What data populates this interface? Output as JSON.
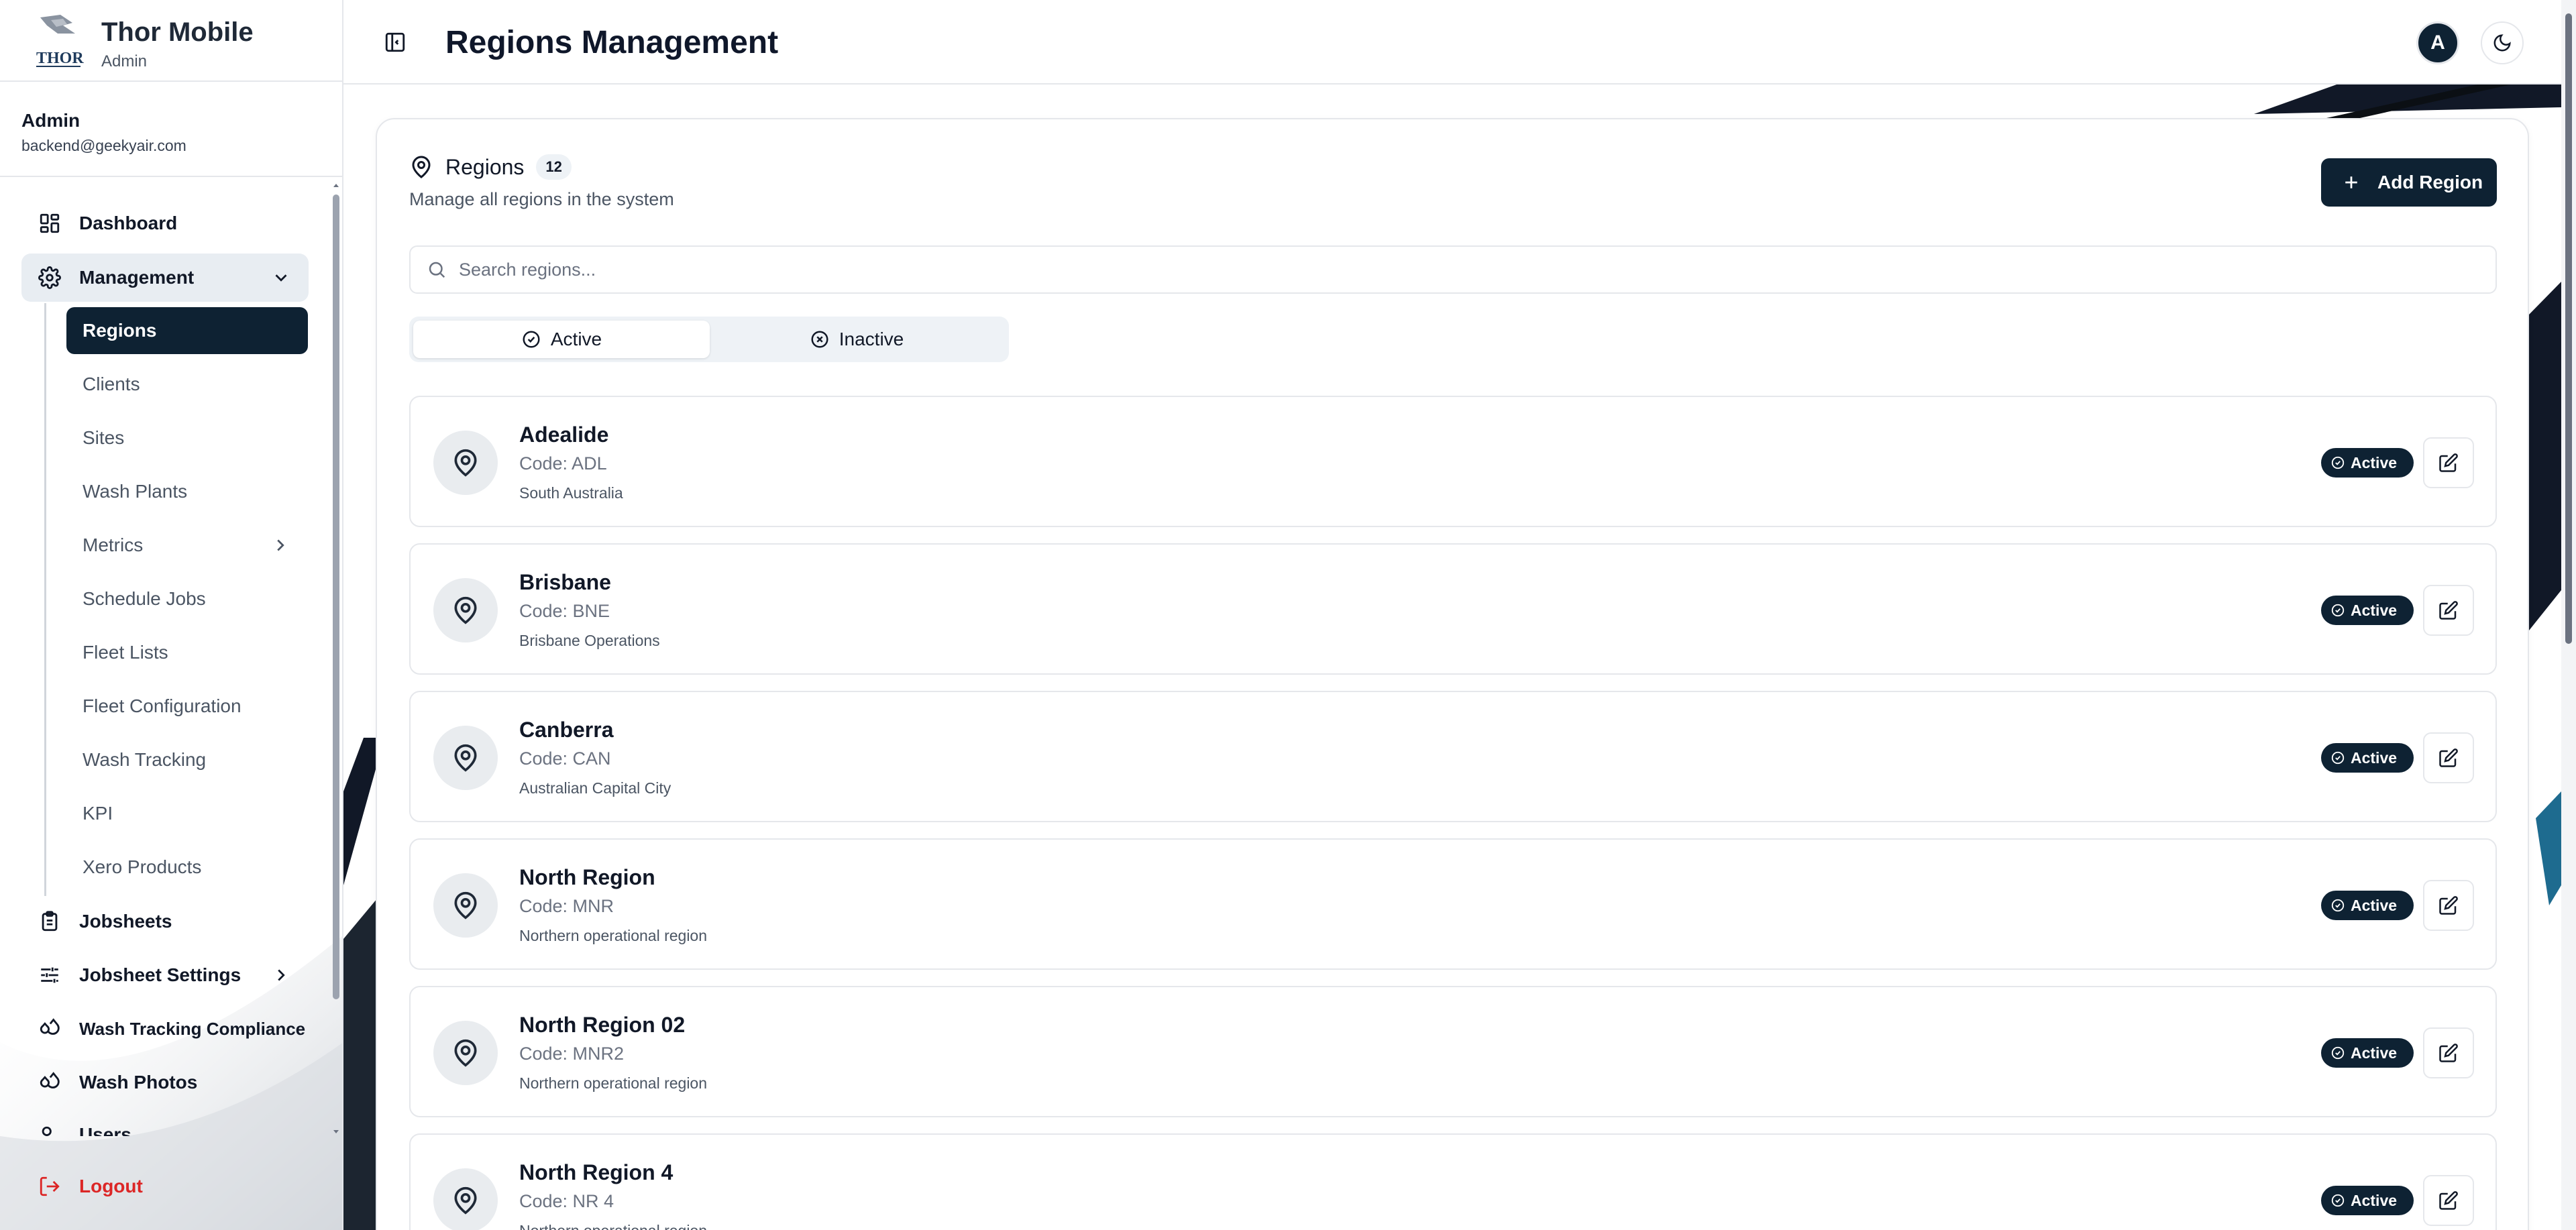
{
  "brand": {
    "name": "Thor Mobile",
    "subtitle": "Admin",
    "logo_text": "THOR"
  },
  "user": {
    "name": "Admin",
    "email": "backend@geekyair.com"
  },
  "nav": {
    "dashboard": "Dashboard",
    "management": "Management",
    "sub": {
      "regions": "Regions",
      "clients": "Clients",
      "sites": "Sites",
      "wash_plants": "Wash Plants",
      "metrics": "Metrics",
      "schedule_jobs": "Schedule Jobs",
      "fleet_lists": "Fleet Lists",
      "fleet_configuration": "Fleet Configuration",
      "wash_tracking": "Wash Tracking",
      "kpi": "KPI",
      "xero_products": "Xero Products"
    },
    "jobsheets": "Jobsheets",
    "jobsheet_settings": "Jobsheet Settings",
    "wash_tracking_compliance": "Wash Tracking Compliance",
    "wash_photos": "Wash Photos",
    "users": "Users",
    "logout": "Logout"
  },
  "header": {
    "title": "Regions Management",
    "avatar_initial": "A"
  },
  "regions": {
    "title": "Regions",
    "count": "12",
    "description": "Manage all regions in the system",
    "add_button": "Add Region",
    "search_placeholder": "Search regions...",
    "search_value": "",
    "tabs": {
      "active": "Active",
      "inactive": "Inactive"
    },
    "status_label": "Active",
    "items": [
      {
        "name": "Adealide",
        "code": "Code: ADL",
        "description": "South Australia"
      },
      {
        "name": "Brisbane",
        "code": "Code: BNE",
        "description": "Brisbane Operations"
      },
      {
        "name": "Canberra",
        "code": "Code: CAN",
        "description": "Australian Capital City"
      },
      {
        "name": "North Region",
        "code": "Code: MNR",
        "description": "Northern operational region"
      },
      {
        "name": "North Region 02",
        "code": "Code: MNR2",
        "description": "Northern operational region"
      },
      {
        "name": "North Region 4",
        "code": "Code: NR 4",
        "description": "Northern operational region"
      }
    ]
  },
  "colors": {
    "primary": "#0e2233",
    "danger": "#dc2626",
    "border": "#e5e7eb",
    "muted": "#6b7280"
  },
  "icons": {
    "dashboard": "layout-grid-icon",
    "management": "gear-icon",
    "jobsheets": "clipboard-icon",
    "jobsheet_settings": "sliders-icon",
    "wash_tracking_compliance": "droplets-icon",
    "wash_photos": "droplets-icon",
    "users": "users-icon",
    "logout": "logout-icon",
    "region": "map-pin-icon",
    "edit": "edit-icon",
    "theme": "moon-icon"
  }
}
